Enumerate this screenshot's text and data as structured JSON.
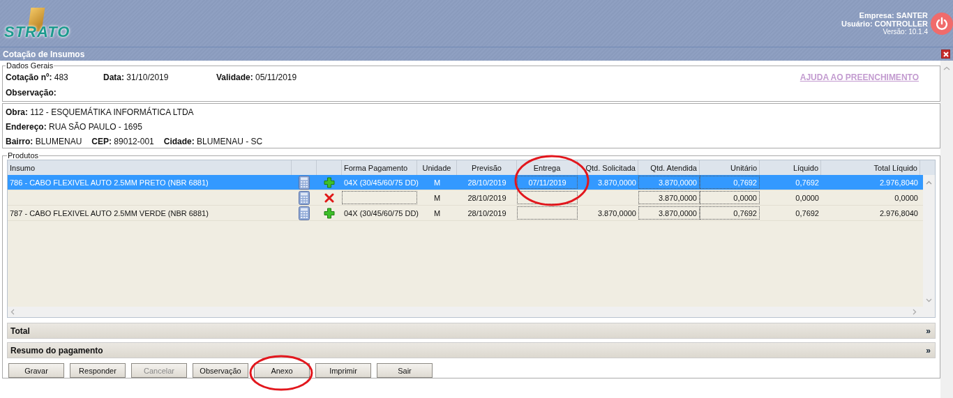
{
  "header": {
    "logo": "STRATO",
    "company": "Empresa: SANTER",
    "user": "Usuário: CONTROLLER",
    "version": "Versão: 10.1.4"
  },
  "window": {
    "title": "Cotação de Insumos"
  },
  "general": {
    "legend": "Dados Gerais",
    "quote_label": "Cotação nº:",
    "quote": "483",
    "date_label": "Data:",
    "date": "31/10/2019",
    "validity_label": "Validade:",
    "validity": "05/11/2019",
    "help_link": "AJUDA AO PREENCHIMENTO",
    "note_label": "Observação:"
  },
  "site": {
    "work_label": "Obra:",
    "work": "112 - ESQUEMÁTIKA INFORMÁTICA LTDA",
    "address_label": "Endereço:",
    "address": "RUA SÃO PAULO - 1695",
    "district_label": "Bairro:",
    "district": "BLUMENAU",
    "zip_label": "CEP:",
    "zip": "89012-001",
    "city_label": "Cidade:",
    "city": "BLUMENAU - SC"
  },
  "products": {
    "legend": "Produtos",
    "columns": [
      "Insumo",
      "Forma Pagamento",
      "Unidade",
      "Previsão",
      "Entrega",
      "Qtd. Solicitada",
      "Qtd. Atendida",
      "Unitário",
      "Líquido",
      "Total Líquido"
    ],
    "rows": [
      {
        "selected": true,
        "kind": "add",
        "insumo": "786 - CABO FLEXIVEL AUTO 2.5MM PRETO (NBR 6881)",
        "forma": "04X (30/45/60/75 DD)",
        "unidade": "M",
        "previsao": "28/10/2019",
        "entrega": "07/11/2019",
        "qtd_solicitada": "3.870,0000",
        "qtd_atendida": "3.870,0000",
        "unitario": "0,7692",
        "liquido": "0,7692",
        "total": "2.976,8040"
      },
      {
        "selected": false,
        "kind": "remove",
        "unidade": "M",
        "previsao": "28/10/2019",
        "qtd_atendida": "3.870,0000",
        "unitario": "0,0000",
        "liquido": "0,0000",
        "total": "0,0000"
      },
      {
        "selected": false,
        "kind": "add",
        "insumo": "787 - CABO FLEXIVEL AUTO 2.5MM VERDE (NBR 6881)",
        "forma": "04X (30/45/60/75 DD)",
        "unidade": "M",
        "previsao": "28/10/2019",
        "qtd_solicitada": "3.870,0000",
        "qtd_atendida": "3.870,0000",
        "unitario": "0,7692",
        "liquido": "0,7692",
        "total": "2.976,8040"
      }
    ]
  },
  "sections": [
    {
      "label": "Total",
      "toggle": "»"
    },
    {
      "label": "Resumo do pagamento",
      "toggle": "»"
    }
  ],
  "buttons": [
    {
      "label": "Gravar",
      "disabled": false
    },
    {
      "label": "Responder",
      "disabled": false
    },
    {
      "label": "Cancelar",
      "disabled": true
    },
    {
      "label": "Observação",
      "disabled": false
    },
    {
      "label": "Anexo",
      "disabled": false
    },
    {
      "label": "Imprimir",
      "disabled": false
    },
    {
      "label": "Sair",
      "disabled": false
    }
  ]
}
